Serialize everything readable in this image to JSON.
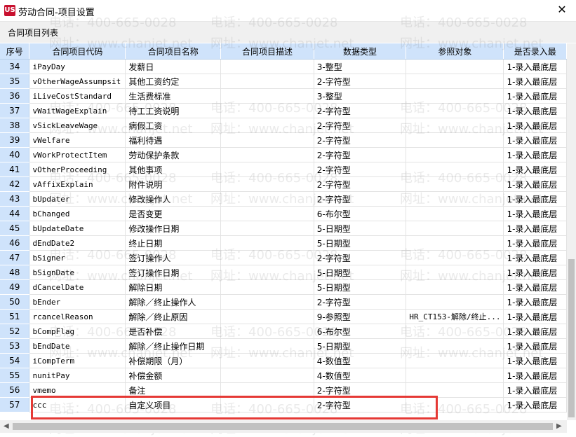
{
  "window": {
    "title": "劳动合同-项目设置",
    "icon_text": "US",
    "close_glyph": "✕"
  },
  "panel": {
    "title": "合同项目列表"
  },
  "columns": [
    "序号",
    "合同项目代码",
    "合同项目名称",
    "合同项目描述",
    "数据类型",
    "参照对象",
    "是否录入最"
  ],
  "rows": [
    {
      "no": "34",
      "code": "iPayDay",
      "name": "发薪日",
      "desc": "",
      "type": "3-整型",
      "ref": "",
      "entry": "1-录入最底层"
    },
    {
      "no": "35",
      "code": "vOtherWageAssumpsit",
      "name": "其他工资约定",
      "desc": "",
      "type": "2-字符型",
      "ref": "",
      "entry": "1-录入最底层"
    },
    {
      "no": "36",
      "code": "iLiveCostStandard",
      "name": "生活费标准",
      "desc": "",
      "type": "3-整型",
      "ref": "",
      "entry": "1-录入最底层"
    },
    {
      "no": "37",
      "code": "vWaitWageExplain",
      "name": "待工工资说明",
      "desc": "",
      "type": "2-字符型",
      "ref": "",
      "entry": "1-录入最底层"
    },
    {
      "no": "38",
      "code": "vSickLeaveWage",
      "name": "病假工资",
      "desc": "",
      "type": "2-字符型",
      "ref": "",
      "entry": "1-录入最底层"
    },
    {
      "no": "39",
      "code": "vWelfare",
      "name": "福利待遇",
      "desc": "",
      "type": "2-字符型",
      "ref": "",
      "entry": "1-录入最底层"
    },
    {
      "no": "40",
      "code": "vWorkProtectItem",
      "name": "劳动保护条款",
      "desc": "",
      "type": "2-字符型",
      "ref": "",
      "entry": "1-录入最底层"
    },
    {
      "no": "41",
      "code": "vOtherProceeding",
      "name": "其他事项",
      "desc": "",
      "type": "2-字符型",
      "ref": "",
      "entry": "1-录入最底层"
    },
    {
      "no": "42",
      "code": "vAffixExplain",
      "name": "附件说明",
      "desc": "",
      "type": "2-字符型",
      "ref": "",
      "entry": "1-录入最底层"
    },
    {
      "no": "43",
      "code": "bUpdater",
      "name": "修改操作人",
      "desc": "",
      "type": "2-字符型",
      "ref": "",
      "entry": "1-录入最底层"
    },
    {
      "no": "44",
      "code": "bChanged",
      "name": "是否变更",
      "desc": "",
      "type": "6-布尔型",
      "ref": "",
      "entry": "1-录入最底层"
    },
    {
      "no": "45",
      "code": "bUpdateDate",
      "name": "修改操作日期",
      "desc": "",
      "type": "5-日期型",
      "ref": "",
      "entry": "1-录入最底层"
    },
    {
      "no": "46",
      "code": "dEndDate2",
      "name": "终止日期",
      "desc": "",
      "type": "5-日期型",
      "ref": "",
      "entry": "1-录入最底层"
    },
    {
      "no": "47",
      "code": "bSigner",
      "name": "签订操作人",
      "desc": "",
      "type": "2-字符型",
      "ref": "",
      "entry": "1-录入最底层"
    },
    {
      "no": "48",
      "code": "bSignDate",
      "name": "签订操作日期",
      "desc": "",
      "type": "5-日期型",
      "ref": "",
      "entry": "1-录入最底层"
    },
    {
      "no": "49",
      "code": "dCancelDate",
      "name": "解除日期",
      "desc": "",
      "type": "5-日期型",
      "ref": "",
      "entry": "1-录入最底层"
    },
    {
      "no": "50",
      "code": "bEnder",
      "name": "解除／终止操作人",
      "desc": "",
      "type": "2-字符型",
      "ref": "",
      "entry": "1-录入最底层"
    },
    {
      "no": "51",
      "code": "rcancelReason",
      "name": "解除／终止原因",
      "desc": "",
      "type": "9-参照型",
      "ref": "HR_CT153-解除/终止...",
      "entry": "1-录入最底层"
    },
    {
      "no": "52",
      "code": "bCompFlag",
      "name": "是否补偿",
      "desc": "",
      "type": "6-布尔型",
      "ref": "",
      "entry": "1-录入最底层"
    },
    {
      "no": "53",
      "code": "bEndDate",
      "name": "解除／终止操作日期",
      "desc": "",
      "type": "5-日期型",
      "ref": "",
      "entry": "1-录入最底层"
    },
    {
      "no": "54",
      "code": "iCompTerm",
      "name": "补偿期限（月）",
      "desc": "",
      "type": "4-数值型",
      "ref": "",
      "entry": "1-录入最底层"
    },
    {
      "no": "55",
      "code": "nunitPay",
      "name": "补偿金额",
      "desc": "",
      "type": "4-数值型",
      "ref": "",
      "entry": "1-录入最底层"
    },
    {
      "no": "56",
      "code": "vmemo",
      "name": "备注",
      "desc": "",
      "type": "2-字符型",
      "ref": "",
      "entry": "1-录入最底层"
    },
    {
      "no": "57",
      "code": "ccc",
      "name": "自定义项目",
      "desc": "",
      "type": "2-字符型",
      "ref": "",
      "entry": "1-录入最底层"
    }
  ],
  "watermarks": {
    "phone": "电话：400-665-0028",
    "site": "网址：www.chanjet.net"
  },
  "colors": {
    "header_bg": "#cfe3fb",
    "highlight_border": "#e53935"
  }
}
